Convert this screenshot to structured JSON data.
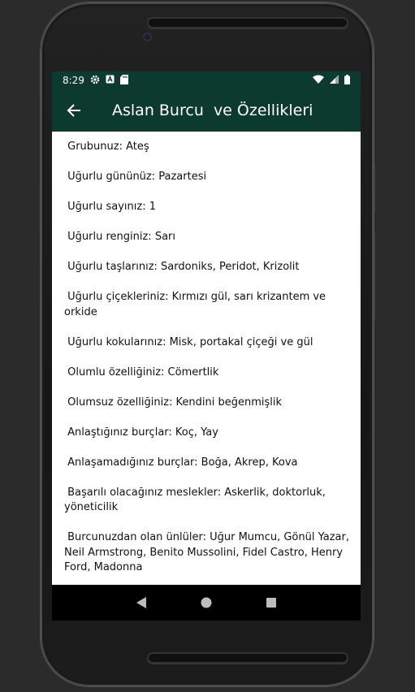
{
  "status": {
    "time": "8:29",
    "icons": [
      "gear-icon",
      "a-icon",
      "sd-card-icon",
      "wifi-icon",
      "signal-icon",
      "battery-icon"
    ]
  },
  "app_bar": {
    "title": "Aslan Burcu  ve Özellikleri",
    "back_icon": "arrow-back-icon",
    "color": "#0c3a2f"
  },
  "traits": [
    " Grubunuz: Ateş",
    " Uğurlu gününüz: Pazartesi",
    " Uğurlu sayınız: 1",
    " Uğurlu renginiz: Sarı",
    " Uğurlu taşlarınız: Sardoniks, Peridot, Krizolit",
    " Uğurlu çiçekleriniz: Kırmızı gül, sarı krizantem ve orkide",
    " Uğurlu kokularınız: Misk, portakal çiçeği ve gül",
    " Olumlu özelliğiniz: Cömertlik",
    " Olumsuz özelliğiniz: Kendini beğenmişlik",
    " Anlaştığınız burçlar: Koç, Yay",
    " Anlaşamadığınız burçlar: Boğa, Akrep, Kova",
    " Başarılı olacağınız meslekler: Askerlik, doktorluk, yöneticilik",
    " Burcunuzdan olan ünlüler: Uğur Mumcu, Gönül Yazar, Neil Armstrong, Benito Mussolini, Fidel Castro, Henry Ford, Madonna"
  ],
  "nav": [
    "back-triangle-icon",
    "home-circle-icon",
    "recents-square-icon"
  ]
}
